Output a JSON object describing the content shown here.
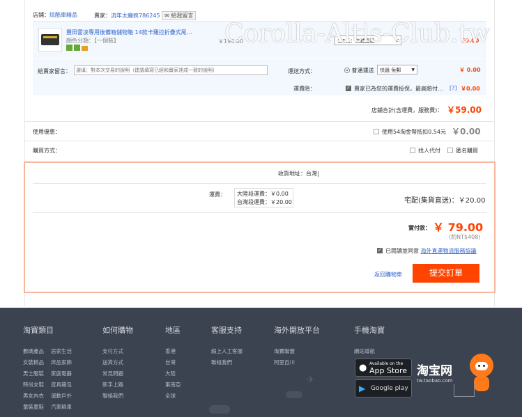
{
  "watermark": "Corolla-Altis-Club.tw",
  "shop": {
    "shop_label": "店鋪：",
    "shop_name": "炫酷車精品",
    "seller_label": "賣家：",
    "seller_name": "流年太癲疯786245",
    "message_button": "給我留言"
  },
  "product": {
    "title": "豐田雷凌專用後備箱儲物箱 14款卡羅拉折疊式尾…",
    "variant": "顏色分類：【一個裝】",
    "price": "￥194.00",
    "promo_select": "省6元：店鋪優惠",
    "subtotal": "59.00"
  },
  "message": {
    "label": "給賣家留言：",
    "placeholder": "選填：對本次交易的說明（建議填寫已經和賣家達成一致的說明）"
  },
  "shipping": {
    "label": "運送方式：",
    "radio_label": "普通運送",
    "select_value": "快遞 免郵",
    "price": "￥ 0.00"
  },
  "insurance": {
    "label": "運費險：",
    "text": "賣家已為您的運費投保，最高賠付…",
    "help": "[?]",
    "price": "￥0.00"
  },
  "store_total": {
    "label": "店鋪合計(含運費，服務費)：",
    "value": "￥59.00"
  },
  "discount": {
    "label": "使用優惠：",
    "option": "使用54淘金幣抵扣0.54元",
    "price": "￥0.00"
  },
  "purchase_mode": {
    "label": "購買方式：",
    "opt1": "找人代付",
    "opt2": "匿名購買"
  },
  "summary": {
    "address": "收貨地址：台灣|",
    "freight_label": "運費：",
    "mainland_freight": "大陸段運費：￥0.00",
    "taiwan_freight": "台灣段運費：￥20.00",
    "delivery": "宅配(集貨直送)：￥20.00",
    "pay_label": "實付款：",
    "pay_value": "￥ 79.00",
    "pay_ntd": "(約NT$408)",
    "agree_text": "已閱讀並同意",
    "agree_link": "海外直運物流服務協議",
    "back_link": "返回購物車",
    "submit": "提交訂單"
  },
  "footer": {
    "columns": [
      {
        "title": "淘寶類目",
        "links": [
          "數碼產品",
          "居家生活",
          "女裝精品",
          "床品家飾",
          "男士服裝",
          "家庭電器",
          "時尚女鞋",
          "皮具箱包",
          "男女內衣",
          "運動戶外",
          "童裝童鞋",
          "汽車精車"
        ]
      },
      {
        "title": "如何購物",
        "links": [
          "支付方式",
          "送貨方式",
          "常見問題",
          "新手上路",
          "聯絡我們"
        ]
      },
      {
        "title": "地區",
        "links": [
          "香港",
          "台灣",
          "大陸",
          "東南亞",
          "全球"
        ]
      },
      {
        "title": "客服支持",
        "links": [
          "線上人工客服",
          "聯絡我們"
        ]
      },
      {
        "title": "海外開放平台",
        "links": [
          "淘寶聯盟",
          "阿里百川"
        ]
      },
      {
        "title": "手機淘寶",
        "links": [
          "網站導航"
        ]
      }
    ],
    "appstore_small": "Available on the",
    "appstore": "App Store",
    "googleplay": "Google play",
    "logo": "淘宝网",
    "logo_sub": "tw.taobao.com"
  }
}
